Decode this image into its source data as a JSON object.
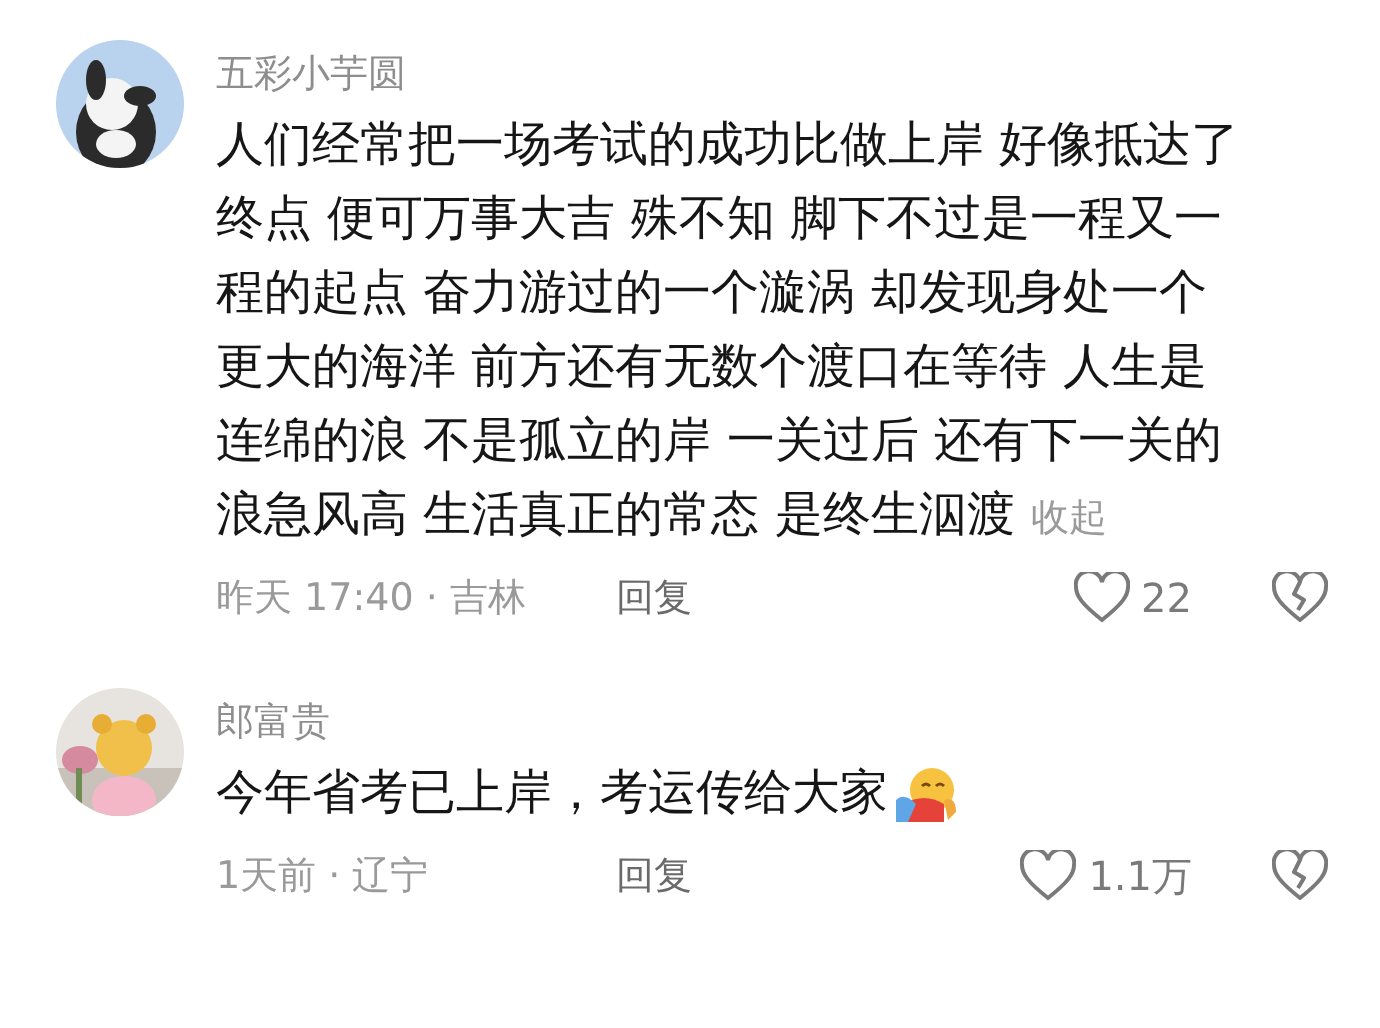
{
  "comments": [
    {
      "author": "五彩小芋圆",
      "lines": [
        "人们经常把一场考试的成功比做上岸 好像抵达了",
        "终点 便可万事大吉 殊不知 脚下不过是一程又一",
        "程的起点 奋力游过的一个漩涡 却发现身处一个",
        "更大的海洋 前方还有无数个渡口在等待 人生是",
        "连绵的浪 不是孤立的岸 一关过后 还有下一关的",
        "浪急风高 生活真正的常态 是终生泅渡"
      ],
      "collapse": "收起",
      "has_emoji": false,
      "meta": "昨天 17:40 · 吉林",
      "reply": "回复",
      "likes": "22"
    },
    {
      "author": "郎富贵",
      "lines": [
        "今年省考已上岸，考运传给大家"
      ],
      "has_emoji": true,
      "meta": "1天前 · 辽宁",
      "reply": "回复",
      "likes": "1.1万"
    }
  ]
}
